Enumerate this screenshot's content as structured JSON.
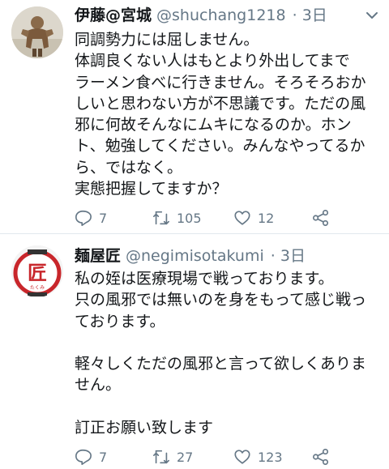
{
  "tweets": [
    {
      "name": "伊藤@宮城",
      "handle": "@shuchang1218",
      "time": "· 3日",
      "body": "同調勢力には屈しません。\n体調良くない人はもとより外出してまで\nラーメン食べに行きません。そろそろおか\nしいと思わない方が不思議です。ただの風\n邪に何故そんなにムキになるのか。ホン\nト、勉強してください。みんなやってるか\nら、ではなく。\n実態把握してますか？",
      "replies": "7",
      "retweets": "105",
      "likes": "12",
      "avatar_icon": "person-photo-avatar"
    },
    {
      "name": "麺屋匠",
      "handle": "@negimisotakumi",
      "time": "· 3日",
      "body": "私の姪は医療現場で戦っております。\n只の風邪では無いのを身をもって感じ戦っ\nております。\n\n軽々しくただの風邪と言って欲しくありま\nせん。\n\n訂正お願い致します",
      "replies": "7",
      "retweets": "27",
      "likes": "123",
      "avatar_text": "匠",
      "avatar_subtext": "たくみ",
      "avatar_icon": "lantern-logo-avatar"
    }
  ],
  "colors": {
    "text": "#14171a",
    "muted": "#657786",
    "divider": "#e1e8ed",
    "lantern_red": "#c8262b"
  }
}
